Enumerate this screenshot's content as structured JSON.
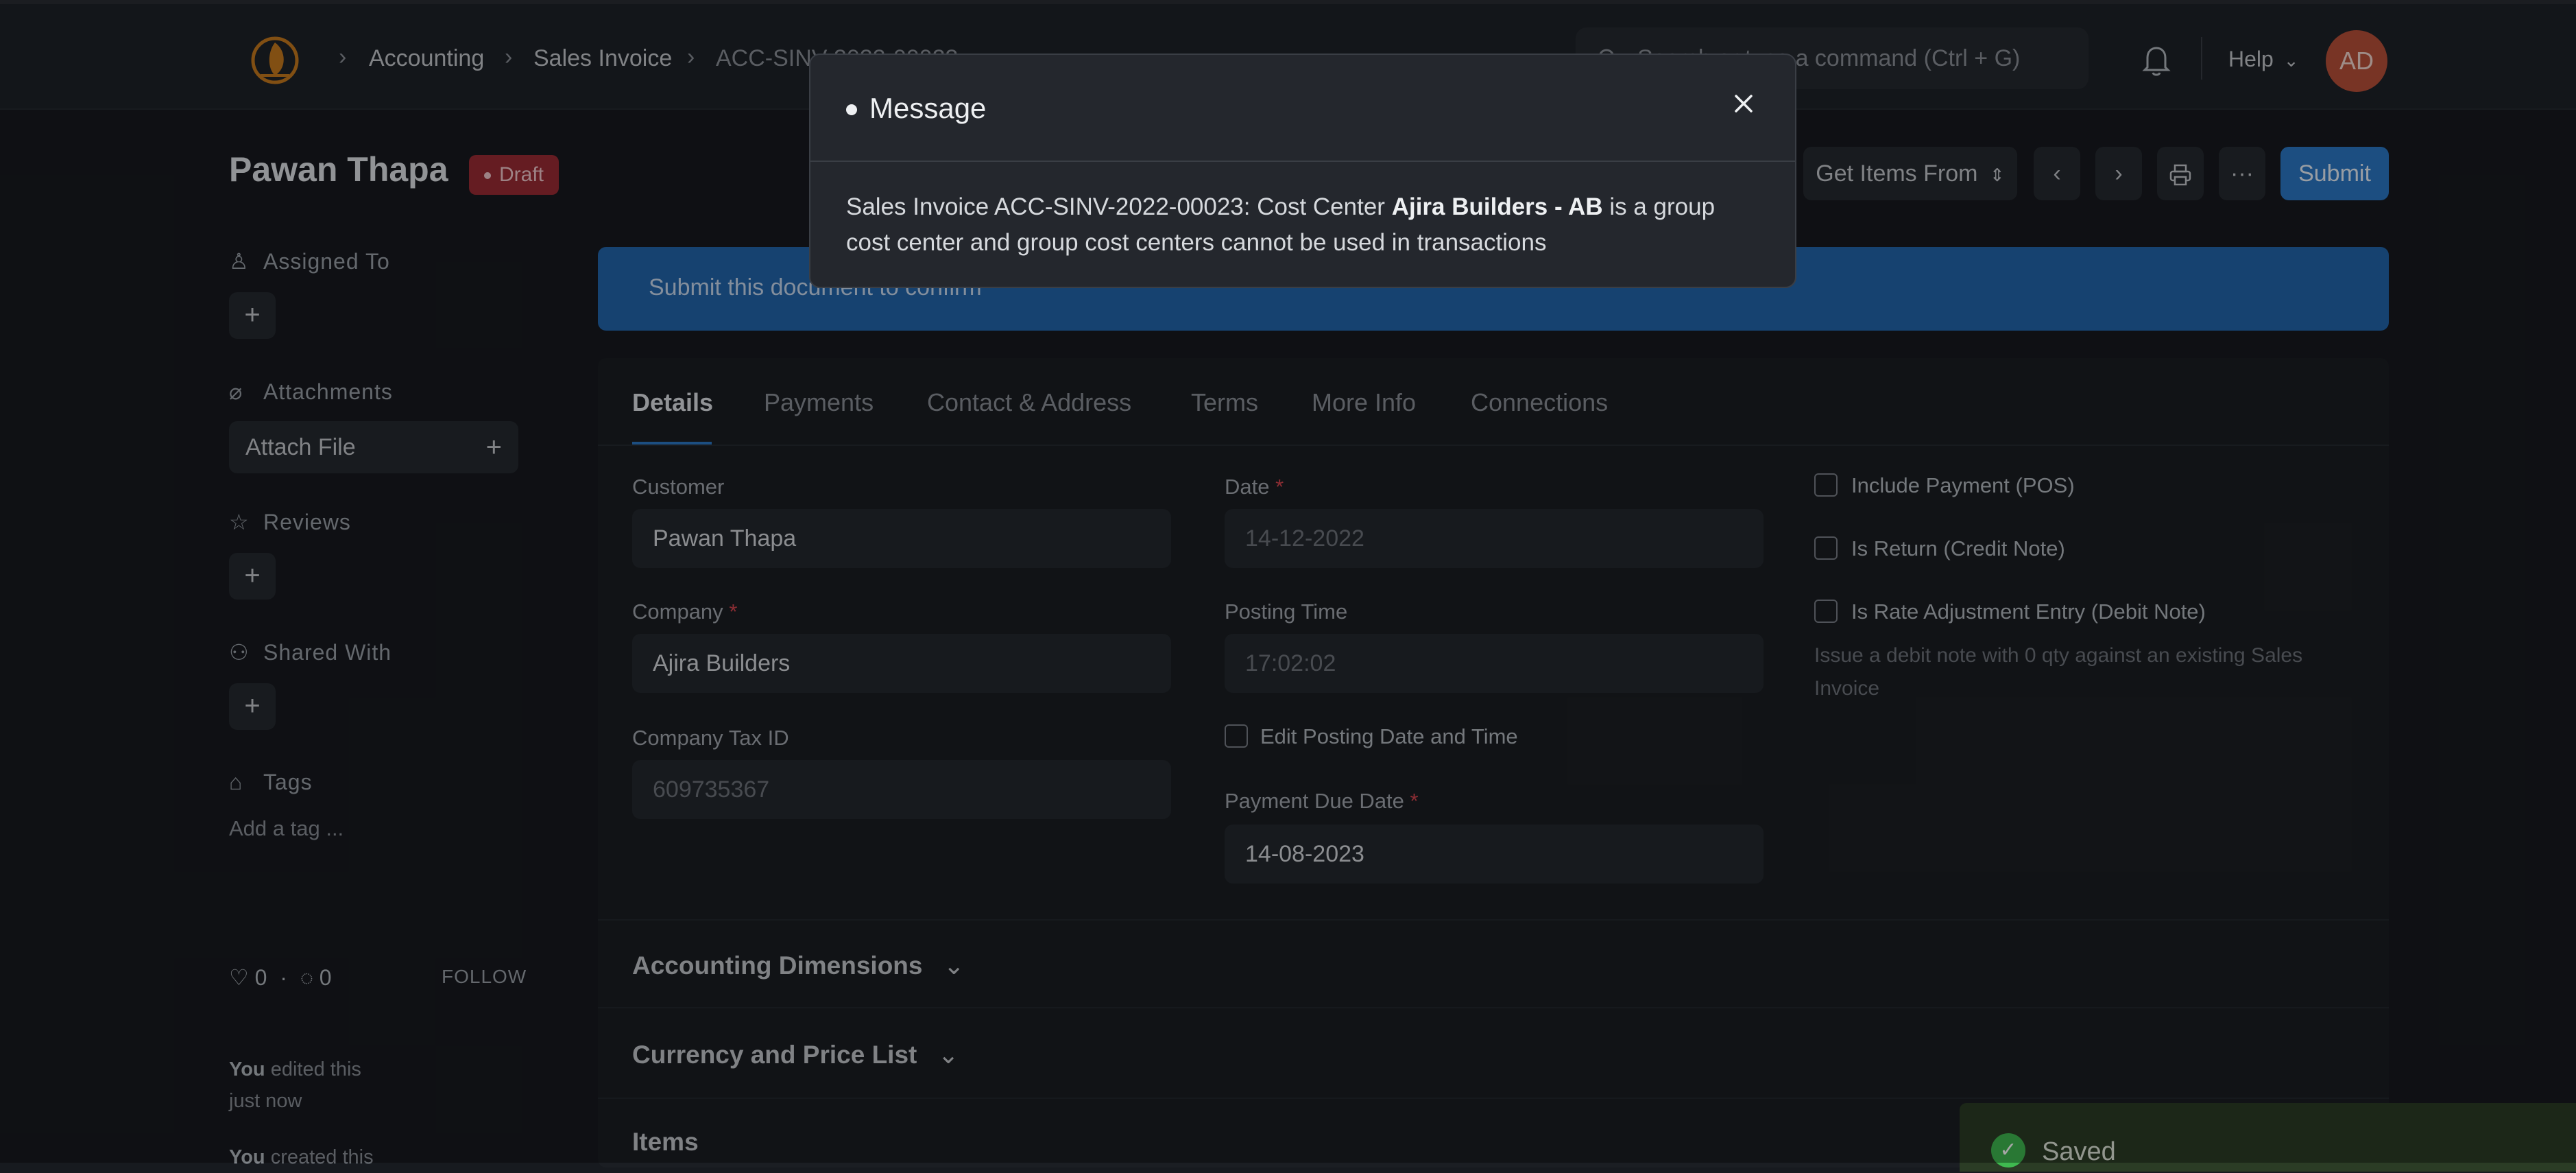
{
  "navbar": {
    "breadcrumbs": [
      "Accounting",
      "Sales Invoice",
      "ACC-SINV-2022-00023"
    ],
    "search_placeholder": "Search or type a command (Ctrl + G)",
    "help_label": "Help",
    "avatar_initials": "AD"
  },
  "header": {
    "title": "Pawan Thapa",
    "status_badge": "Draft",
    "get_items_label": "Get Items From",
    "submit_label": "Submit"
  },
  "sidebar": {
    "assigned_to": "Assigned To",
    "attachments": "Attachments",
    "attach_file": "Attach File",
    "reviews": "Reviews",
    "shared_with": "Shared With",
    "tags": "Tags",
    "add_tag": "Add a tag ...",
    "likes": "0",
    "comments": "0",
    "follow": "FOLLOW",
    "activity": [
      {
        "actor": "You",
        "text": "edited this",
        "when": "just now"
      },
      {
        "actor": "You",
        "text": "created this",
        "when": ""
      }
    ]
  },
  "banner": {
    "text": "Submit this document to confirm"
  },
  "tabs": [
    "Details",
    "Payments",
    "Contact & Address",
    "Terms",
    "More Info",
    "Connections"
  ],
  "form": {
    "customer": {
      "label": "Customer",
      "value": "Pawan Thapa"
    },
    "company": {
      "label": "Company",
      "value": "Ajira Builders"
    },
    "company_tax_id": {
      "label": "Company Tax ID",
      "value": "609735367"
    },
    "date": {
      "label": "Date",
      "value": "14-12-2022"
    },
    "posting_time": {
      "label": "Posting Time",
      "value": "17:02:02"
    },
    "edit_posting": {
      "label": "Edit Posting Date and Time",
      "checked": false
    },
    "payment_due_date": {
      "label": "Payment Due Date",
      "value": "14-08-2023"
    },
    "include_payment": {
      "label": "Include Payment (POS)",
      "checked": false
    },
    "is_return": {
      "label": "Is Return (Credit Note)",
      "checked": false
    },
    "is_rate_adjustment": {
      "label": "Is Rate Adjustment Entry (Debit Note)",
      "checked": false
    },
    "rate_adjustment_desc": "Issue a debit note with 0 qty against an existing Sales Invoice"
  },
  "sections": {
    "accounting_dimensions": "Accounting Dimensions",
    "currency_price_list": "Currency and Price List",
    "items": "Items"
  },
  "toast": {
    "text": "Saved"
  },
  "modal": {
    "title": "Message",
    "body_prefix": "Sales Invoice ACC-SINV-2022-00023: Cost Center ",
    "body_bold": "Ajira Builders - AB",
    "body_suffix": " is a group cost center and group cost centers cannot be used in transactions"
  },
  "colors": {
    "accent": "#2b78c6",
    "draft": "#9b2c35",
    "avatar": "#b9503a",
    "toast": "#2b3c25"
  }
}
